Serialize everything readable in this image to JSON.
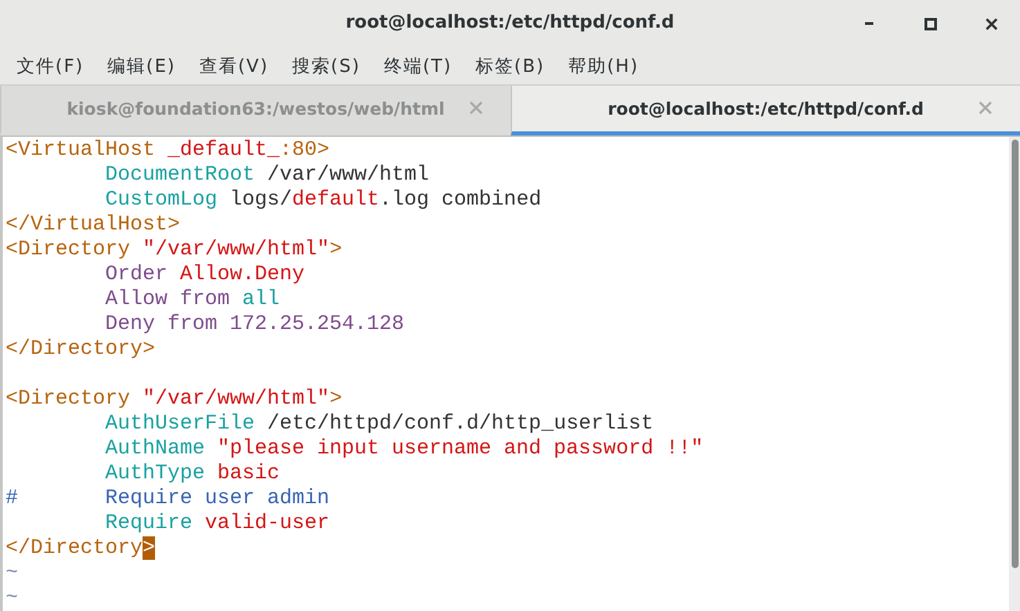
{
  "window": {
    "title": "root@localhost:/etc/httpd/conf.d"
  },
  "menu": [
    "文件(F)",
    "编辑(E)",
    "查看(V)",
    "搜索(S)",
    "终端(T)",
    "标签(B)",
    "帮助(H)"
  ],
  "tabs": [
    {
      "label": "kiosk@foundation63:/westos/web/html",
      "selected": false
    },
    {
      "label": "root@localhost:/etc/httpd/conf.d",
      "selected": true
    }
  ],
  "lines": [
    {
      "indented": false,
      "segments": [
        {
          "kind": "tag",
          "text": "<VirtualHost "
        },
        {
          "kind": "string",
          "text": "_default_"
        },
        {
          "kind": "tag",
          "text": ":80>"
        }
      ]
    },
    {
      "indented": true,
      "segments": [
        {
          "kind": "keyword",
          "text": "DocumentRoot "
        },
        {
          "kind": "plain",
          "text": "/var/www/html"
        }
      ]
    },
    {
      "indented": true,
      "segments": [
        {
          "kind": "keyword",
          "text": "CustomLog "
        },
        {
          "kind": "plain",
          "text": "logs/"
        },
        {
          "kind": "string",
          "text": "default"
        },
        {
          "kind": "plain",
          "text": ".log combined"
        }
      ]
    },
    {
      "indented": false,
      "segments": [
        {
          "kind": "tag",
          "text": "</VirtualHost>"
        }
      ]
    },
    {
      "indented": false,
      "segments": [
        {
          "kind": "tag",
          "text": "<Directory "
        },
        {
          "kind": "string",
          "text": "\"/var/www/html\""
        },
        {
          "kind": "tag",
          "text": ">"
        }
      ]
    },
    {
      "indented": true,
      "segments": [
        {
          "kind": "purple",
          "text": "Order "
        },
        {
          "kind": "string",
          "text": "Allow.Deny"
        }
      ]
    },
    {
      "indented": true,
      "segments": [
        {
          "kind": "purple",
          "text": "Allow from "
        },
        {
          "kind": "keyword",
          "text": "all"
        }
      ]
    },
    {
      "indented": true,
      "segments": [
        {
          "kind": "purple",
          "text": "Deny from 172.25.254.128"
        }
      ]
    },
    {
      "indented": false,
      "segments": [
        {
          "kind": "tag",
          "text": "</Directory>"
        }
      ]
    },
    {
      "indented": false,
      "gap_before": true,
      "segments": [
        {
          "kind": "tag",
          "text": "<Directory "
        },
        {
          "kind": "string",
          "text": "\"/var/www/html\""
        },
        {
          "kind": "tag",
          "text": ">"
        }
      ]
    },
    {
      "indented": true,
      "segments": [
        {
          "kind": "keyword",
          "text": "AuthUserFile "
        },
        {
          "kind": "plain",
          "text": "/etc/httpd/conf.d/http_userlist"
        }
      ]
    },
    {
      "indented": true,
      "segments": [
        {
          "kind": "keyword",
          "text": "AuthName "
        },
        {
          "kind": "string",
          "text": "\"please input username and password !!\""
        }
      ]
    },
    {
      "indented": true,
      "segments": [
        {
          "kind": "keyword",
          "text": "AuthType "
        },
        {
          "kind": "string",
          "text": "basic"
        }
      ]
    },
    {
      "indented": true,
      "marker": "#",
      "segments": [
        {
          "kind": "comment",
          "text": "Require user admin"
        }
      ]
    },
    {
      "indented": true,
      "segments": [
        {
          "kind": "keyword",
          "text": "Require "
        },
        {
          "kind": "string",
          "text": "valid-user"
        }
      ]
    },
    {
      "indented": false,
      "segments": [
        {
          "kind": "tag",
          "text": "</Directory"
        },
        {
          "kind": "cursor",
          "text": ">"
        }
      ]
    },
    {
      "indented": false,
      "segments": [
        {
          "kind": "tilde",
          "text": "~"
        }
      ]
    },
    {
      "indented": false,
      "segments": [
        {
          "kind": "tilde",
          "text": "~"
        }
      ]
    }
  ]
}
